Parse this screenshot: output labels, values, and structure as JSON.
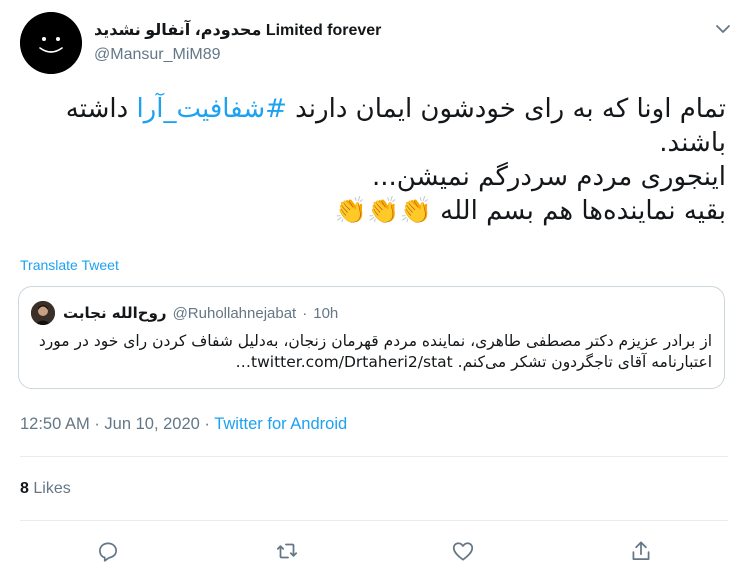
{
  "author": {
    "display_name": "محدودم، آنفالو نشدید Limited forever",
    "handle": "@Mansur_MiM89"
  },
  "tweet": {
    "line1_pre": "تمام اونا که به رای خودشون ایمان دارند ",
    "hashtag": "#شفافیت_آرا",
    "line1_post": " داشته باشند.",
    "line2": "اینجوری مردم سردرگم نمیشن...",
    "line3_text": "بقیه نماینده‌ها هم بسم الله ",
    "line3_emoji": "👏👏👏"
  },
  "translate_label": "Translate Tweet",
  "quoted": {
    "name": "روح‌الله نجابت",
    "handle": "@Ruhollahnejabat",
    "time": "10h",
    "text": "از برادر عزیزم دکتر مصطفی طاهری، نماینده مردم قهرمان زنجان، به‌دلیل شفاف کردن رای خود در مورد اعتبارنامه آقای تاجگردون تشکر می‌کنم. twitter.com/Drtaheri2/stat…"
  },
  "meta": {
    "time": "12:50 AM",
    "date": "Jun 10, 2020",
    "source": "Twitter for Android"
  },
  "likes": {
    "count": "8",
    "label": "Likes"
  },
  "icons": {
    "reply": "reply-icon",
    "retweet": "retweet-icon",
    "like": "heart-icon",
    "share": "share-icon",
    "more": "chevron-down-icon"
  },
  "colors": {
    "accent": "#1da1f2",
    "muted": "#657786",
    "border": "#ccd6dd",
    "text": "#14171a"
  }
}
